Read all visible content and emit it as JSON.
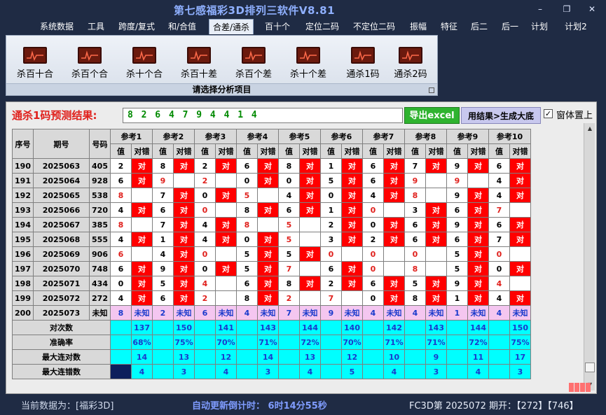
{
  "window": {
    "title": "第七感福彩3D排列三软件V8.81",
    "buttons": [
      "minimize-icon",
      "restore-icon",
      "close-icon"
    ]
  },
  "menu": [
    "系统数据",
    "工具",
    "跨度/复式",
    "和/合值",
    "合差/通杀",
    "百十个",
    "定位二码",
    "不定位二码",
    "振幅",
    "特征",
    "后二",
    "后一",
    "计划",
    "计划2"
  ],
  "menu_active": "合差/通杀",
  "ribbon": {
    "buttons": [
      "杀百十合",
      "杀百个合",
      "杀十个合",
      "杀百十差",
      "杀百个差",
      "杀十个差",
      "通杀1码",
      "通杀2码"
    ],
    "caption": "请选择分析项目"
  },
  "result": {
    "label": "通杀1码预测结果:",
    "value": "8 2 6 4 7 9 4 4 1 4",
    "export_label": "导出excel",
    "generate_label": "用结果>生成大底",
    "pin_label": "窗体置上",
    "pin_checked": true
  },
  "grid": {
    "headers": [
      "序号",
      "期号",
      "号码"
    ],
    "ref_headers": [
      "参考1",
      "参考2",
      "参考3",
      "参考4",
      "参考5",
      "参考6",
      "参考7",
      "参考8",
      "参考9",
      "参考10"
    ],
    "sub_headers": [
      "值",
      "对错"
    ],
    "ok_text": "对",
    "rows": [
      {
        "seq": "190",
        "issue": "2025063",
        "num": "405",
        "cells": [
          [
            "2",
            true
          ],
          [
            "8",
            true
          ],
          [
            "2",
            true
          ],
          [
            "6",
            true
          ],
          [
            "8",
            true
          ],
          [
            "1",
            true
          ],
          [
            "6",
            true
          ],
          [
            "7",
            true
          ],
          [
            "9",
            true
          ],
          [
            "6",
            true
          ]
        ]
      },
      {
        "seq": "191",
        "issue": "2025064",
        "num": "928",
        "cells": [
          [
            "6",
            true
          ],
          [
            "9",
            false
          ],
          [
            "2",
            false
          ],
          [
            "0",
            true
          ],
          [
            "0",
            true
          ],
          [
            "5",
            true
          ],
          [
            "6",
            true
          ],
          [
            "9",
            false
          ],
          [
            "9",
            false
          ],
          [
            "4",
            true
          ]
        ]
      },
      {
        "seq": "192",
        "issue": "2025065",
        "num": "538",
        "cells": [
          [
            "8",
            false
          ],
          [
            "7",
            true
          ],
          [
            "0",
            true
          ],
          [
            "5",
            false
          ],
          [
            "4",
            true
          ],
          [
            "0",
            true
          ],
          [
            "4",
            true
          ],
          [
            "8",
            false
          ],
          [
            "9",
            true
          ],
          [
            "4",
            true
          ]
        ]
      },
      {
        "seq": "193",
        "issue": "2025066",
        "num": "720",
        "cells": [
          [
            "4",
            true
          ],
          [
            "6",
            true
          ],
          [
            "0",
            false
          ],
          [
            "8",
            true
          ],
          [
            "6",
            true
          ],
          [
            "1",
            true
          ],
          [
            "0",
            false
          ],
          [
            "3",
            true
          ],
          [
            "6",
            true
          ],
          [
            "7",
            false
          ]
        ]
      },
      {
        "seq": "194",
        "issue": "2025067",
        "num": "385",
        "cells": [
          [
            "8",
            false
          ],
          [
            "7",
            true
          ],
          [
            "4",
            true
          ],
          [
            "8",
            false
          ],
          [
            "5",
            false
          ],
          [
            "2",
            true
          ],
          [
            "0",
            true
          ],
          [
            "6",
            true
          ],
          [
            "9",
            true
          ],
          [
            "6",
            true
          ]
        ]
      },
      {
        "seq": "195",
        "issue": "2025068",
        "num": "555",
        "cells": [
          [
            "4",
            true
          ],
          [
            "1",
            true
          ],
          [
            "4",
            true
          ],
          [
            "0",
            true
          ],
          [
            "5",
            false
          ],
          [
            "3",
            true
          ],
          [
            "2",
            true
          ],
          [
            "6",
            true
          ],
          [
            "6",
            true
          ],
          [
            "7",
            true
          ]
        ]
      },
      {
        "seq": "196",
        "issue": "2025069",
        "num": "906",
        "cells": [
          [
            "6",
            false
          ],
          [
            "4",
            true
          ],
          [
            "0",
            false
          ],
          [
            "5",
            true
          ],
          [
            "5",
            true
          ],
          [
            "0",
            false
          ],
          [
            "0",
            false
          ],
          [
            "0",
            false
          ],
          [
            "5",
            true
          ],
          [
            "0",
            false
          ]
        ]
      },
      {
        "seq": "197",
        "issue": "2025070",
        "num": "748",
        "cells": [
          [
            "6",
            true
          ],
          [
            "9",
            true
          ],
          [
            "0",
            true
          ],
          [
            "5",
            true
          ],
          [
            "7",
            false
          ],
          [
            "6",
            true
          ],
          [
            "0",
            false
          ],
          [
            "8",
            false
          ],
          [
            "5",
            true
          ],
          [
            "0",
            true
          ]
        ]
      },
      {
        "seq": "198",
        "issue": "2025071",
        "num": "434",
        "cells": [
          [
            "0",
            true
          ],
          [
            "5",
            true
          ],
          [
            "4",
            false
          ],
          [
            "6",
            true
          ],
          [
            "8",
            true
          ],
          [
            "2",
            true
          ],
          [
            "6",
            true
          ],
          [
            "5",
            true
          ],
          [
            "9",
            true
          ],
          [
            "4",
            false
          ]
        ]
      },
      {
        "seq": "199",
        "issue": "2025072",
        "num": "272",
        "cells": [
          [
            "4",
            true
          ],
          [
            "6",
            true
          ],
          [
            "2",
            false
          ],
          [
            "8",
            true
          ],
          [
            "2",
            false
          ],
          [
            "7",
            false
          ],
          [
            "0",
            true
          ],
          [
            "8",
            true
          ],
          [
            "1",
            true
          ],
          [
            "4",
            true
          ]
        ]
      }
    ],
    "unknown_row": {
      "seq": "200",
      "issue": "2025073",
      "num": "未知",
      "values": [
        "8",
        "2",
        "6",
        "4",
        "7",
        "9",
        "4",
        "4",
        "1",
        "4"
      ],
      "status": "未知"
    },
    "stats": [
      {
        "label": "对次数",
        "values": [
          "137",
          "150",
          "141",
          "143",
          "144",
          "140",
          "142",
          "143",
          "144",
          "150"
        ]
      },
      {
        "label": "准确率",
        "values": [
          "68%",
          "75%",
          "70%",
          "71%",
          "72%",
          "70%",
          "71%",
          "71%",
          "72%",
          "75%"
        ]
      },
      {
        "label": "最大连对数",
        "values": [
          "14",
          "13",
          "12",
          "14",
          "13",
          "12",
          "10",
          "9",
          "11",
          "17"
        ]
      },
      {
        "label": "最大连错数",
        "values": [
          "4",
          "3",
          "4",
          "3",
          "4",
          "5",
          "4",
          "3",
          "4",
          "3"
        ]
      }
    ]
  },
  "status_bar": {
    "current_data": "当前数据为：[福彩3D]",
    "countdown": "自动更新倒计时： 6时14分55秒",
    "draw_info": "FC3D第 2025072 期开：【272】【746】"
  },
  "colors": {
    "accent_red": "#ff0000",
    "stat_cyan": "#00ffff",
    "unknown_pink": "#f4c6f0",
    "export_green": "#2fb32f"
  }
}
